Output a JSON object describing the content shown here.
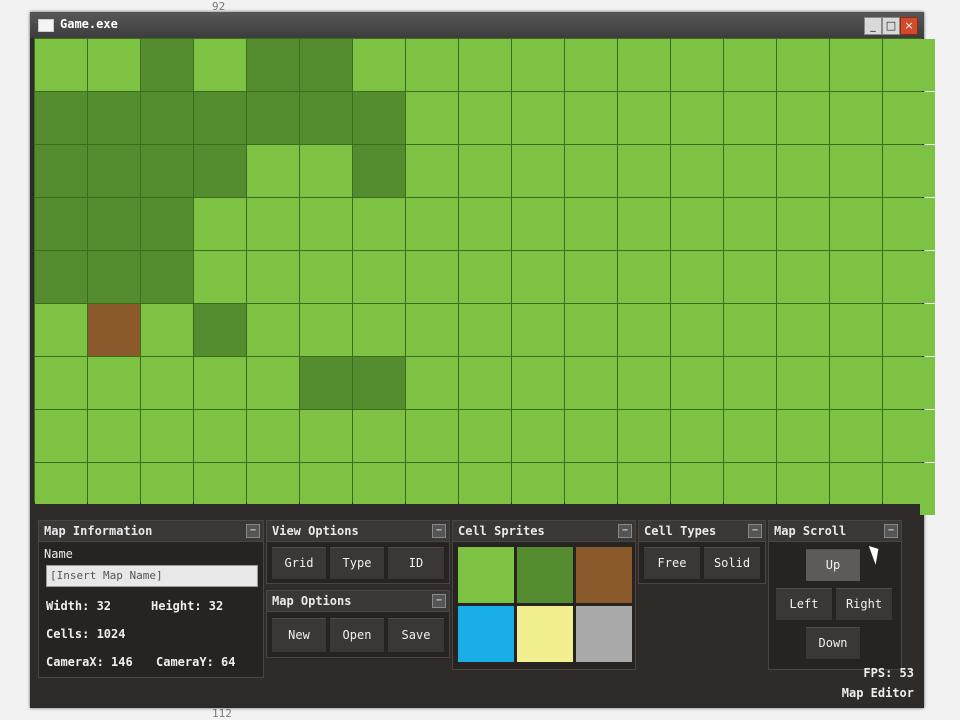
{
  "window": {
    "title": "Game.exe"
  },
  "map": {
    "rows": [
      [
        "#7dc242",
        "#7dc242",
        "#548c2f",
        "#7dc242",
        "#548c2f",
        "#548c2f",
        "#7dc242",
        "#7dc242",
        "#7dc242",
        "#7dc242",
        "#7dc242",
        "#7dc242",
        "#7dc242",
        "#7dc242",
        "#7dc242",
        "#7dc242",
        "#7dc242"
      ],
      [
        "#548c2f",
        "#548c2f",
        "#548c2f",
        "#548c2f",
        "#548c2f",
        "#548c2f",
        "#548c2f",
        "#7dc242",
        "#7dc242",
        "#7dc242",
        "#7dc242",
        "#7dc242",
        "#7dc242",
        "#7dc242",
        "#7dc242",
        "#7dc242",
        "#7dc242"
      ],
      [
        "#548c2f",
        "#548c2f",
        "#548c2f",
        "#548c2f",
        "#7dc242",
        "#7dc242",
        "#548c2f",
        "#7dc242",
        "#7dc242",
        "#7dc242",
        "#7dc242",
        "#7dc242",
        "#7dc242",
        "#7dc242",
        "#7dc242",
        "#7dc242",
        "#7dc242"
      ],
      [
        "#548c2f",
        "#548c2f",
        "#548c2f",
        "#7dc242",
        "#7dc242",
        "#7dc242",
        "#7dc242",
        "#7dc242",
        "#7dc242",
        "#7dc242",
        "#7dc242",
        "#7dc242",
        "#7dc242",
        "#7dc242",
        "#7dc242",
        "#7dc242",
        "#7dc242"
      ],
      [
        "#548c2f",
        "#548c2f",
        "#548c2f",
        "#7dc242",
        "#7dc242",
        "#7dc242",
        "#7dc242",
        "#7dc242",
        "#7dc242",
        "#7dc242",
        "#7dc242",
        "#7dc242",
        "#7dc242",
        "#7dc242",
        "#7dc242",
        "#7dc242",
        "#7dc242"
      ],
      [
        "#7dc242",
        "#8b5a2b",
        "#7dc242",
        "#548c2f",
        "#7dc242",
        "#7dc242",
        "#7dc242",
        "#7dc242",
        "#7dc242",
        "#7dc242",
        "#7dc242",
        "#7dc242",
        "#7dc242",
        "#7dc242",
        "#7dc242",
        "#7dc242",
        "#7dc242"
      ],
      [
        "#7dc242",
        "#7dc242",
        "#7dc242",
        "#7dc242",
        "#7dc242",
        "#548c2f",
        "#548c2f",
        "#7dc242",
        "#7dc242",
        "#7dc242",
        "#7dc242",
        "#7dc242",
        "#7dc242",
        "#7dc242",
        "#7dc242",
        "#7dc242",
        "#7dc242"
      ],
      [
        "#7dc242",
        "#7dc242",
        "#7dc242",
        "#7dc242",
        "#7dc242",
        "#7dc242",
        "#7dc242",
        "#7dc242",
        "#7dc242",
        "#7dc242",
        "#7dc242",
        "#7dc242",
        "#7dc242",
        "#7dc242",
        "#7dc242",
        "#7dc242",
        "#7dc242"
      ],
      [
        "#7dc242",
        "#7dc242",
        "#7dc242",
        "#7dc242",
        "#7dc242",
        "#7dc242",
        "#7dc242",
        "#7dc242",
        "#7dc242",
        "#7dc242",
        "#7dc242",
        "#7dc242",
        "#7dc242",
        "#7dc242",
        "#7dc242",
        "#7dc242",
        "#7dc242"
      ]
    ]
  },
  "map_information": {
    "title": "Map Information",
    "name_label": "Name",
    "name_placeholder": "[Insert Map Name]",
    "width": "Width: 32",
    "height": "Height: 32",
    "cells": "Cells: 1024",
    "camera_x": "CameraX: 146",
    "camera_y": "CameraY: 64"
  },
  "view_options": {
    "title": "View Options",
    "buttons": [
      "Grid",
      "Type",
      "ID"
    ]
  },
  "map_options": {
    "title": "Map Options",
    "buttons": [
      "New",
      "Open",
      "Save"
    ]
  },
  "cell_sprites": {
    "title": "Cell Sprites",
    "colors": [
      "#7dc242",
      "#548c2f",
      "#8b5a2b",
      "#1aaee8",
      "#f1ef8e",
      "#a9a9a9"
    ]
  },
  "cell_types": {
    "title": "Cell Types",
    "buttons": [
      "Free",
      "Solid"
    ]
  },
  "map_scroll": {
    "title": "Map Scroll",
    "up": "Up",
    "left": "Left",
    "right": "Right",
    "down": "Down"
  },
  "status": {
    "fps": "FPS: 53",
    "mode": "Map Editor"
  }
}
